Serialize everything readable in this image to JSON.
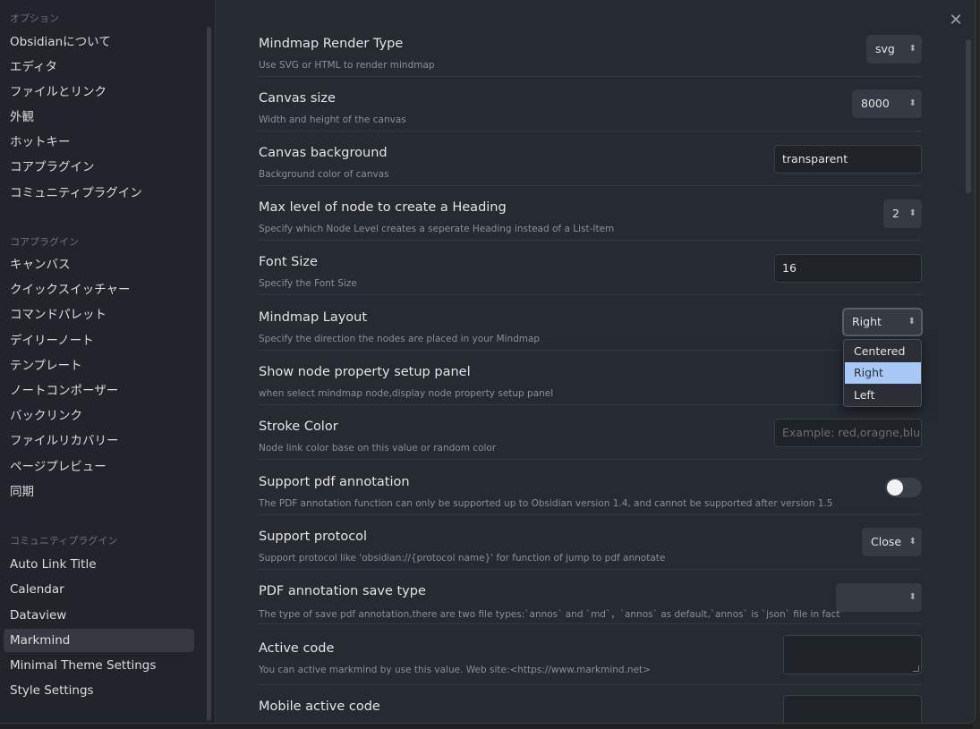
{
  "sidebar": {
    "sections": [
      {
        "heading": "オプション",
        "items": [
          "Obsidianについて",
          "エディタ",
          "ファイルとリンク",
          "外観",
          "ホットキー",
          "コアプラグイン",
          "コミュニティプラグイン"
        ]
      },
      {
        "heading": "コアプラグイン",
        "items": [
          "キャンバス",
          "クイックスイッチャー",
          "コマンドパレット",
          "デイリーノート",
          "テンプレート",
          "ノートコンポーザー",
          "バックリンク",
          "ファイルリカバリー",
          "ページプレビュー",
          "同期"
        ]
      },
      {
        "heading": "コミュニティプラグイン",
        "items": [
          "Auto Link Title",
          "Calendar",
          "Dataview",
          "Markmind",
          "Minimal Theme Settings",
          "Style Settings"
        ]
      }
    ],
    "active_item": "Markmind"
  },
  "close_icon": "close-icon",
  "settings": [
    {
      "name": "Mindmap Render Type",
      "desc": "Use SVG or HTML to render mindmap",
      "control": "select",
      "value": "svg"
    },
    {
      "name": "Canvas size",
      "desc": "Width and height of the canvas",
      "control": "select",
      "value": "8000"
    },
    {
      "name": "Canvas background",
      "desc": "Background color of canvas",
      "control": "text",
      "value": "transparent"
    },
    {
      "name": "Max level of node to create a Heading",
      "desc": "Specify which Node Level creates a seperate Heading instead of a List-Item",
      "control": "select",
      "value": "2"
    },
    {
      "name": "Font Size",
      "desc": "Specify the Font Size",
      "control": "text",
      "value": "16"
    },
    {
      "name": "Mindmap Layout",
      "desc": "Specify the direction the nodes are placed in your Mindmap",
      "control": "select",
      "value": "Right"
    },
    {
      "name": "Show node property setup panel",
      "desc": "when select mindmap node,display node property setup panel",
      "control": "none"
    },
    {
      "name": "Stroke Color",
      "desc": "Node link color base on this value or random color",
      "control": "text",
      "value": "",
      "placeholder": "Example: red,oragne,blue"
    },
    {
      "name": "Support pdf annotation",
      "desc": "The PDF annotation function can only be supported up to Obsidian version 1.4, and cannot be supported after version 1.5",
      "control": "toggle",
      "on": false
    },
    {
      "name": "Support protocol",
      "desc": "Support protocol like 'obsidian://{protocol name}' for function of jump to pdf annotate",
      "control": "select",
      "value": "Close"
    },
    {
      "name": "PDF annotation save type",
      "desc": "The type of save pdf annotation,there are two file types:`annos` and `md`，`annos` as default,`annos` is `json` file in fact",
      "control": "select",
      "value": ""
    },
    {
      "name": "Active code",
      "desc": "You can active markmind by use this value. Web site:<https://www.markmind.net>",
      "control": "textarea",
      "value": ""
    },
    {
      "name": "Mobile active code",
      "desc": "",
      "control": "textarea",
      "value": ""
    }
  ],
  "layout_dropdown": {
    "options": [
      "Centered",
      "Right",
      "Left"
    ],
    "selected": "Right"
  },
  "colors": {
    "modal_bg": "#262a31",
    "sidebar_bg": "#21242a",
    "selected_option": "#a8c8f8"
  }
}
